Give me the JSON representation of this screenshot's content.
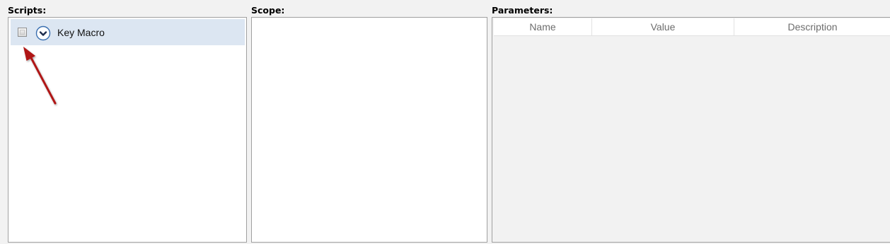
{
  "sections": {
    "scripts_label": "Scripts:",
    "scope_label": "Scope:",
    "parameters_label": "Parameters:"
  },
  "scripts": {
    "items": [
      {
        "label": "Key Macro",
        "checked": false,
        "selected": true
      }
    ]
  },
  "parameters": {
    "columns": [
      "Name",
      "Value",
      "Description"
    ]
  },
  "annotation": {
    "arrow_color": "#b01818"
  }
}
